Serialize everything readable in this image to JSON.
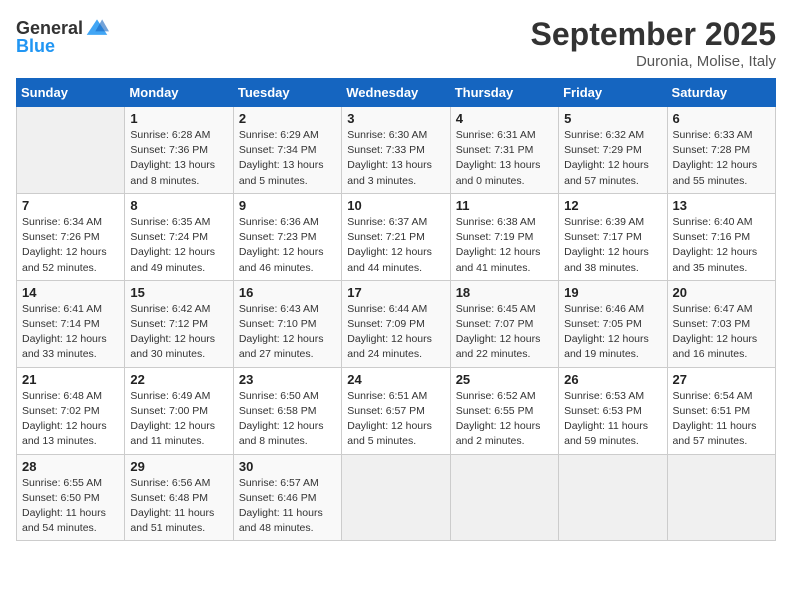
{
  "header": {
    "logo_general": "General",
    "logo_blue": "Blue",
    "month_title": "September 2025",
    "subtitle": "Duronia, Molise, Italy"
  },
  "days_of_week": [
    "Sunday",
    "Monday",
    "Tuesday",
    "Wednesday",
    "Thursday",
    "Friday",
    "Saturday"
  ],
  "weeks": [
    [
      {
        "day": "",
        "sunrise": "",
        "sunset": "",
        "daylight": ""
      },
      {
        "day": "1",
        "sunrise": "Sunrise: 6:28 AM",
        "sunset": "Sunset: 7:36 PM",
        "daylight": "Daylight: 13 hours and 8 minutes."
      },
      {
        "day": "2",
        "sunrise": "Sunrise: 6:29 AM",
        "sunset": "Sunset: 7:34 PM",
        "daylight": "Daylight: 13 hours and 5 minutes."
      },
      {
        "day": "3",
        "sunrise": "Sunrise: 6:30 AM",
        "sunset": "Sunset: 7:33 PM",
        "daylight": "Daylight: 13 hours and 3 minutes."
      },
      {
        "day": "4",
        "sunrise": "Sunrise: 6:31 AM",
        "sunset": "Sunset: 7:31 PM",
        "daylight": "Daylight: 13 hours and 0 minutes."
      },
      {
        "day": "5",
        "sunrise": "Sunrise: 6:32 AM",
        "sunset": "Sunset: 7:29 PM",
        "daylight": "Daylight: 12 hours and 57 minutes."
      },
      {
        "day": "6",
        "sunrise": "Sunrise: 6:33 AM",
        "sunset": "Sunset: 7:28 PM",
        "daylight": "Daylight: 12 hours and 55 minutes."
      }
    ],
    [
      {
        "day": "7",
        "sunrise": "Sunrise: 6:34 AM",
        "sunset": "Sunset: 7:26 PM",
        "daylight": "Daylight: 12 hours and 52 minutes."
      },
      {
        "day": "8",
        "sunrise": "Sunrise: 6:35 AM",
        "sunset": "Sunset: 7:24 PM",
        "daylight": "Daylight: 12 hours and 49 minutes."
      },
      {
        "day": "9",
        "sunrise": "Sunrise: 6:36 AM",
        "sunset": "Sunset: 7:23 PM",
        "daylight": "Daylight: 12 hours and 46 minutes."
      },
      {
        "day": "10",
        "sunrise": "Sunrise: 6:37 AM",
        "sunset": "Sunset: 7:21 PM",
        "daylight": "Daylight: 12 hours and 44 minutes."
      },
      {
        "day": "11",
        "sunrise": "Sunrise: 6:38 AM",
        "sunset": "Sunset: 7:19 PM",
        "daylight": "Daylight: 12 hours and 41 minutes."
      },
      {
        "day": "12",
        "sunrise": "Sunrise: 6:39 AM",
        "sunset": "Sunset: 7:17 PM",
        "daylight": "Daylight: 12 hours and 38 minutes."
      },
      {
        "day": "13",
        "sunrise": "Sunrise: 6:40 AM",
        "sunset": "Sunset: 7:16 PM",
        "daylight": "Daylight: 12 hours and 35 minutes."
      }
    ],
    [
      {
        "day": "14",
        "sunrise": "Sunrise: 6:41 AM",
        "sunset": "Sunset: 7:14 PM",
        "daylight": "Daylight: 12 hours and 33 minutes."
      },
      {
        "day": "15",
        "sunrise": "Sunrise: 6:42 AM",
        "sunset": "Sunset: 7:12 PM",
        "daylight": "Daylight: 12 hours and 30 minutes."
      },
      {
        "day": "16",
        "sunrise": "Sunrise: 6:43 AM",
        "sunset": "Sunset: 7:10 PM",
        "daylight": "Daylight: 12 hours and 27 minutes."
      },
      {
        "day": "17",
        "sunrise": "Sunrise: 6:44 AM",
        "sunset": "Sunset: 7:09 PM",
        "daylight": "Daylight: 12 hours and 24 minutes."
      },
      {
        "day": "18",
        "sunrise": "Sunrise: 6:45 AM",
        "sunset": "Sunset: 7:07 PM",
        "daylight": "Daylight: 12 hours and 22 minutes."
      },
      {
        "day": "19",
        "sunrise": "Sunrise: 6:46 AM",
        "sunset": "Sunset: 7:05 PM",
        "daylight": "Daylight: 12 hours and 19 minutes."
      },
      {
        "day": "20",
        "sunrise": "Sunrise: 6:47 AM",
        "sunset": "Sunset: 7:03 PM",
        "daylight": "Daylight: 12 hours and 16 minutes."
      }
    ],
    [
      {
        "day": "21",
        "sunrise": "Sunrise: 6:48 AM",
        "sunset": "Sunset: 7:02 PM",
        "daylight": "Daylight: 12 hours and 13 minutes."
      },
      {
        "day": "22",
        "sunrise": "Sunrise: 6:49 AM",
        "sunset": "Sunset: 7:00 PM",
        "daylight": "Daylight: 12 hours and 11 minutes."
      },
      {
        "day": "23",
        "sunrise": "Sunrise: 6:50 AM",
        "sunset": "Sunset: 6:58 PM",
        "daylight": "Daylight: 12 hours and 8 minutes."
      },
      {
        "day": "24",
        "sunrise": "Sunrise: 6:51 AM",
        "sunset": "Sunset: 6:57 PM",
        "daylight": "Daylight: 12 hours and 5 minutes."
      },
      {
        "day": "25",
        "sunrise": "Sunrise: 6:52 AM",
        "sunset": "Sunset: 6:55 PM",
        "daylight": "Daylight: 12 hours and 2 minutes."
      },
      {
        "day": "26",
        "sunrise": "Sunrise: 6:53 AM",
        "sunset": "Sunset: 6:53 PM",
        "daylight": "Daylight: 11 hours and 59 minutes."
      },
      {
        "day": "27",
        "sunrise": "Sunrise: 6:54 AM",
        "sunset": "Sunset: 6:51 PM",
        "daylight": "Daylight: 11 hours and 57 minutes."
      }
    ],
    [
      {
        "day": "28",
        "sunrise": "Sunrise: 6:55 AM",
        "sunset": "Sunset: 6:50 PM",
        "daylight": "Daylight: 11 hours and 54 minutes."
      },
      {
        "day": "29",
        "sunrise": "Sunrise: 6:56 AM",
        "sunset": "Sunset: 6:48 PM",
        "daylight": "Daylight: 11 hours and 51 minutes."
      },
      {
        "day": "30",
        "sunrise": "Sunrise: 6:57 AM",
        "sunset": "Sunset: 6:46 PM",
        "daylight": "Daylight: 11 hours and 48 minutes."
      },
      {
        "day": "",
        "sunrise": "",
        "sunset": "",
        "daylight": ""
      },
      {
        "day": "",
        "sunrise": "",
        "sunset": "",
        "daylight": ""
      },
      {
        "day": "",
        "sunrise": "",
        "sunset": "",
        "daylight": ""
      },
      {
        "day": "",
        "sunrise": "",
        "sunset": "",
        "daylight": ""
      }
    ]
  ]
}
